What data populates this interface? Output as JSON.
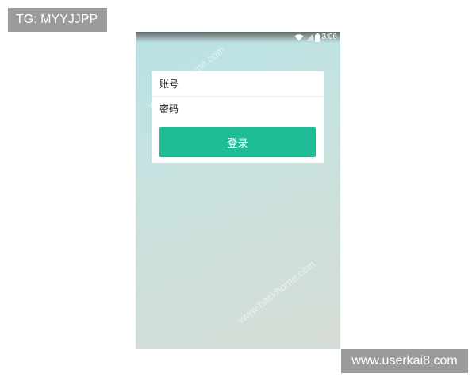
{
  "overlay": {
    "tg_label": "TG: MYYJJPP",
    "site_label": "www.userkai8.com"
  },
  "status_bar": {
    "time": "3:06",
    "icons": [
      "wifi-icon",
      "signal-icon",
      "battery-icon"
    ]
  },
  "login": {
    "account_placeholder": "账号",
    "account_value": "",
    "password_placeholder": "密码",
    "password_value": "",
    "login_button_label": "登录",
    "accent_color": "#1ebd98"
  },
  "watermark": {
    "text": "www.hackhome.com"
  }
}
